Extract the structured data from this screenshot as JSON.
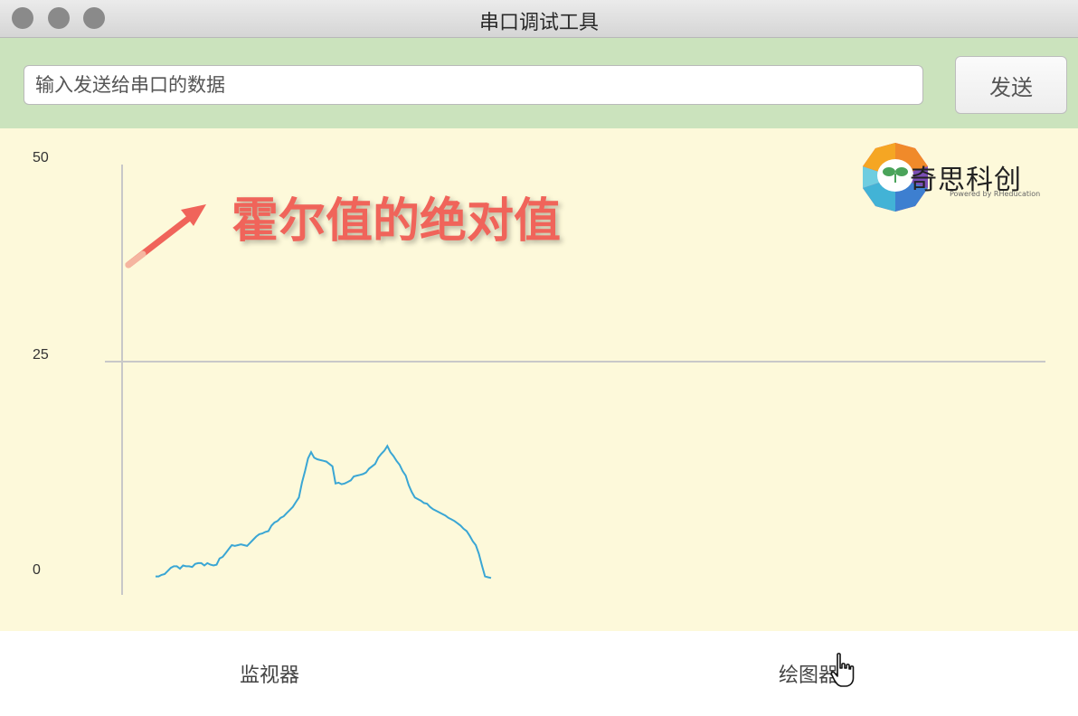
{
  "window": {
    "title": "串口调试工具"
  },
  "send_bar": {
    "placeholder": "输入发送给串口的数据",
    "value": "",
    "button_label": "发送"
  },
  "annotation": "霍尔值的绝对值",
  "logo": {
    "text": "奇思科创",
    "subtitle": "Powered by RHeducation"
  },
  "tabs": [
    {
      "label": "监视器"
    },
    {
      "label": "绘图器"
    }
  ],
  "colors": {
    "line": "#3aa6d4",
    "annotation": "#f0645a",
    "plot_bg": "#fdf9da",
    "toolbar_bg": "#cbe3bd"
  },
  "chart_data": {
    "type": "line",
    "title": "",
    "xlabel": "",
    "ylabel": "",
    "ylim": [
      0,
      50
    ],
    "yticks": [
      "50",
      "25",
      "0"
    ],
    "grid_lines": [
      25
    ],
    "series": [
      {
        "values": [
          -2.5,
          -2.5,
          -2.3,
          -2.2,
          -1.8,
          -1.4,
          -1.2,
          -1.2,
          -1.5,
          -1.1,
          -1.2,
          -1.2,
          -1.3,
          -0.9,
          -0.8,
          -0.8,
          -1.1,
          -0.8,
          -1.0,
          -1.1,
          -1.0,
          -0.2,
          0.0,
          0.5,
          1.0,
          1.5,
          1.4,
          1.5,
          1.6,
          1.5,
          1.4,
          1.8,
          2.2,
          2.6,
          2.9,
          3.0,
          3.2,
          3.3,
          4.0,
          4.4,
          4.6,
          5.0,
          5.2,
          5.6,
          6.0,
          6.4,
          7.0,
          7.6,
          9.5,
          11.0,
          12.6,
          13.4,
          12.7,
          12.5,
          12.4,
          12.3,
          12.2,
          11.9,
          11.6,
          9.4,
          9.5,
          9.3,
          9.4,
          9.6,
          9.8,
          10.3,
          10.4,
          10.5,
          10.6,
          10.8,
          11.3,
          11.6,
          11.9,
          12.7,
          13.2,
          13.6,
          14.2,
          13.4,
          12.9,
          12.3,
          11.8,
          11.0,
          10.4,
          9.2,
          8.3,
          7.6,
          7.4,
          7.2,
          6.9,
          6.8,
          6.4,
          6.1,
          5.9,
          5.7,
          5.5,
          5.3,
          5.0,
          4.8,
          4.6,
          4.3,
          4.0,
          3.6,
          3.3,
          2.7,
          2.0,
          1.5,
          0.4,
          -1.1,
          -2.5,
          -2.6,
          -2.7
        ]
      }
    ],
    "line_color": "#3aa6d4"
  }
}
